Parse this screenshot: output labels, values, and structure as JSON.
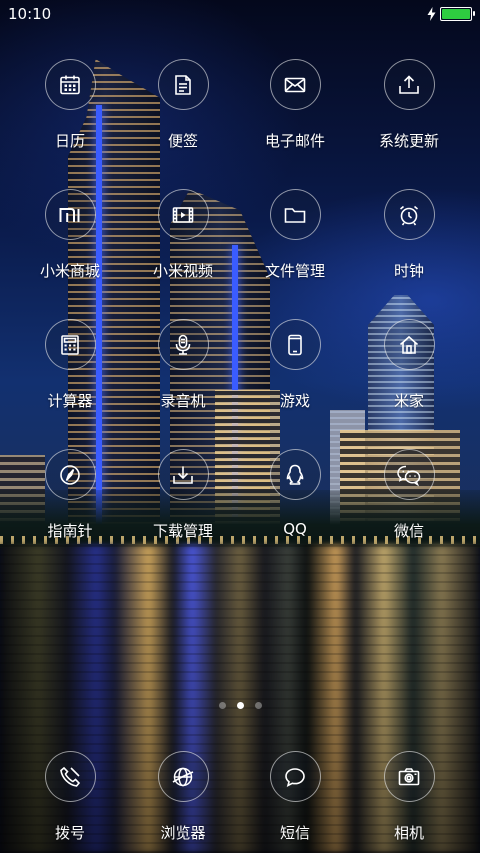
{
  "status_bar": {
    "time": "10:10",
    "battery_level": 1.0,
    "battery_color": "#2ecc40",
    "charging": true
  },
  "wallpaper": "city-night-skyline",
  "apps": [
    {
      "label": "日历",
      "icon": "calendar-icon"
    },
    {
      "label": "便签",
      "icon": "notes-icon"
    },
    {
      "label": "电子邮件",
      "icon": "email-icon"
    },
    {
      "label": "系统更新",
      "icon": "system-update-icon"
    },
    {
      "label": "小米商城",
      "icon": "mi-store-icon"
    },
    {
      "label": "小米视频",
      "icon": "video-icon"
    },
    {
      "label": "文件管理",
      "icon": "folder-icon"
    },
    {
      "label": "时钟",
      "icon": "alarm-clock-icon"
    },
    {
      "label": "计算器",
      "icon": "calculator-icon"
    },
    {
      "label": "录音机",
      "icon": "microphone-icon"
    },
    {
      "label": "游戏",
      "icon": "game-phone-icon"
    },
    {
      "label": "米家",
      "icon": "home-icon"
    },
    {
      "label": "指南针",
      "icon": "compass-icon"
    },
    {
      "label": "下载管理",
      "icon": "download-icon"
    },
    {
      "label": "QQ",
      "icon": "qq-penguin-icon"
    },
    {
      "label": "微信",
      "icon": "wechat-icon"
    }
  ],
  "page_indicator": {
    "count": 3,
    "current": 2
  },
  "dock": [
    {
      "label": "拨号",
      "icon": "phone-icon"
    },
    {
      "label": "浏览器",
      "icon": "browser-globe-icon"
    },
    {
      "label": "短信",
      "icon": "message-icon"
    },
    {
      "label": "相机",
      "icon": "camera-icon"
    }
  ]
}
